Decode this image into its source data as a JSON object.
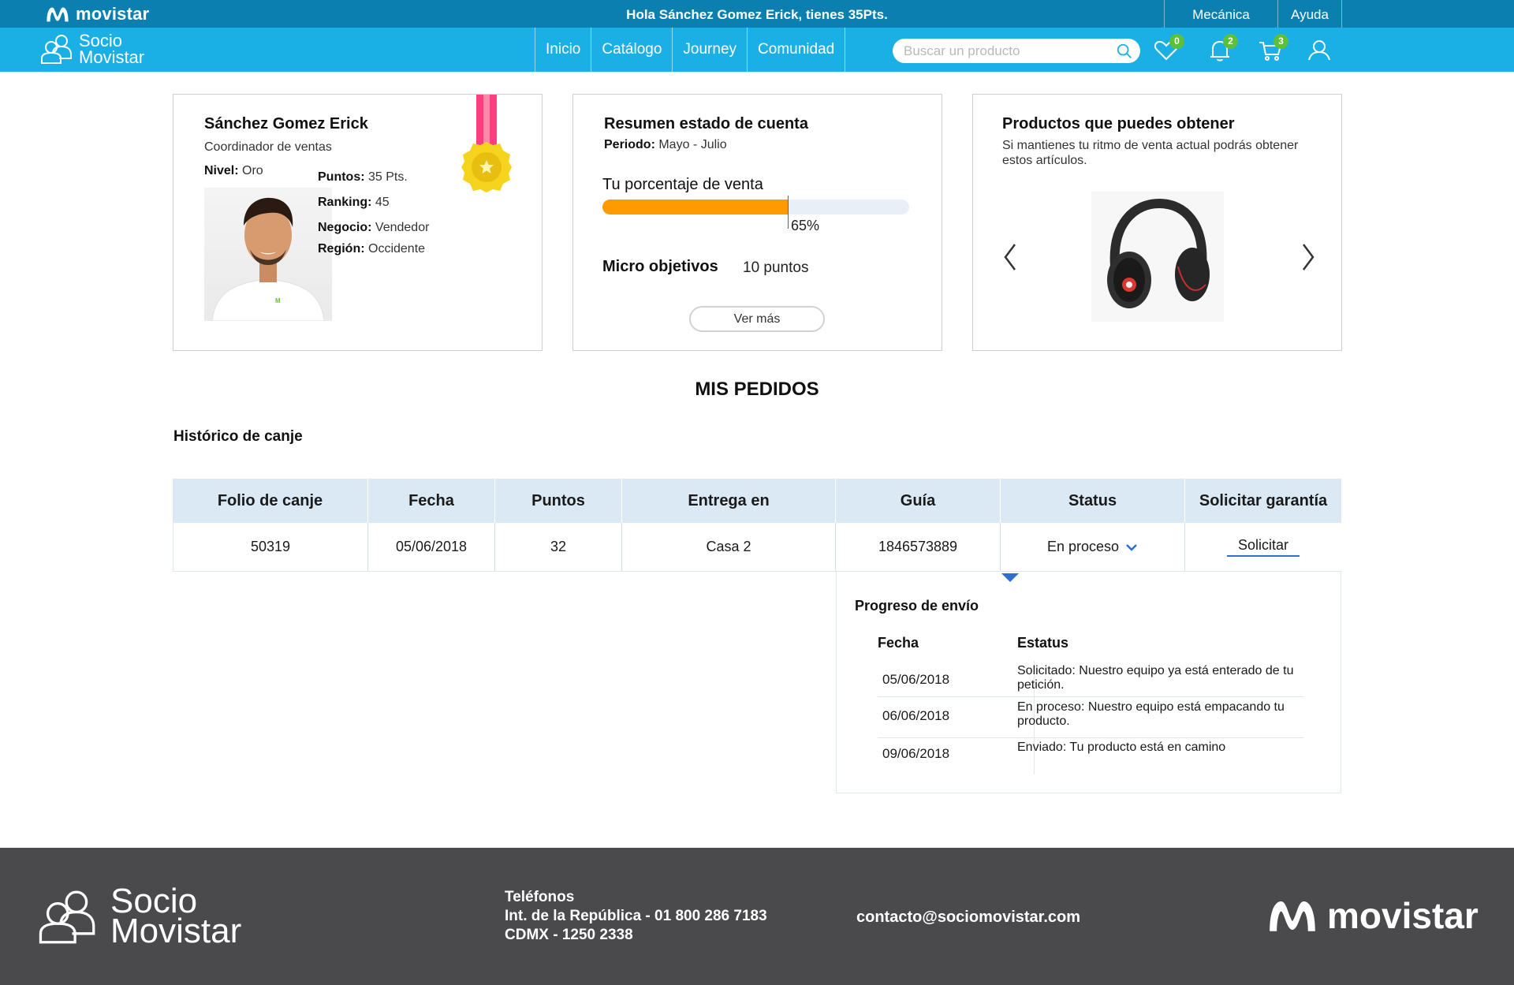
{
  "topbar": {
    "brand": "movistar",
    "greeting": "Hola Sánchez Gomez Erick, tienes 35Pts.",
    "links": [
      "Mecánica",
      "Ayuda"
    ]
  },
  "nav": {
    "brand_line1": "Socio",
    "brand_line2": "Movistar",
    "items": [
      "Inicio",
      "Catálogo",
      "Journey",
      "Comunidad"
    ],
    "search_placeholder": "Buscar un producto",
    "favorites_count": "0",
    "notifications_count": "2",
    "cart_count": "3",
    "icons": [
      "search-icon",
      "heart-icon",
      "bell-icon",
      "cart-icon",
      "user-icon"
    ]
  },
  "profile": {
    "name": "Sánchez Gomez Erick",
    "role": "Coordinador de ventas",
    "nivel_label": "Nivel:",
    "nivel": "Oro",
    "puntos_label": "Puntos:",
    "puntos": "35 Pts.",
    "ranking_label": "Ranking:",
    "ranking": "45",
    "negocio_label": "Negocio:",
    "negocio": "Vendedor",
    "region_label": "Región:",
    "region": "Occidente"
  },
  "account": {
    "title": "Resumen estado de cuenta",
    "periodo_label": "Periodo:",
    "periodo": "Mayo - Julio",
    "sales_label": "Tu porcentaje de venta",
    "sales_percent": 65,
    "sales_percent_text": "65%",
    "micro_label": "Micro objetivos",
    "micro_value": "10 puntos",
    "button": "Ver más"
  },
  "products": {
    "title": "Productos que puedes obtener",
    "subtitle": "Si mantienes tu ritmo de venta actual podrás obtener estos artículos."
  },
  "orders": {
    "section_title": "MIS PEDIDOS",
    "subtitle": "Histórico de canje",
    "columns": [
      "Folio de canje",
      "Fecha",
      "Puntos",
      "Entrega en",
      "Guía",
      "Status",
      "Solicitar garantía"
    ],
    "row": {
      "folio": "50319",
      "fecha": "05/06/2018",
      "puntos": "32",
      "entrega": "Casa 2",
      "guia": "1846573889",
      "status": "En proceso",
      "action": "Solicitar"
    },
    "progress": {
      "title": "Progreso de envío",
      "col_fecha": "Fecha",
      "col_estatus": "Estatus",
      "rows": [
        {
          "date": "05/06/2018",
          "label": "Solicitado:",
          "text": "Nuestro equipo ya está enterado de tu petición."
        },
        {
          "date": "06/06/2018",
          "label": "En proceso:",
          "text": "Nuestro equipo está empacando tu producto."
        },
        {
          "date": "09/06/2018",
          "label": "Enviado:",
          "text": "Tu producto está en camino"
        }
      ]
    }
  },
  "footer": {
    "brand_line1": "Socio",
    "brand_line2": "Movistar",
    "tel_label": "Teléfonos",
    "tel1": "Int. de la República - 01 800 286 7183",
    "tel2": "CDMX - 1250 2338",
    "email": "contacto@sociomovistar.com",
    "logo": "movistar"
  },
  "colors": {
    "topbar": "#0a7fb0",
    "navbar": "#1ab0e6",
    "progress": "#ff9a00",
    "badge": "#5cc03a",
    "table_header": "#dbe9f5",
    "footer": "#4a4a4d"
  }
}
